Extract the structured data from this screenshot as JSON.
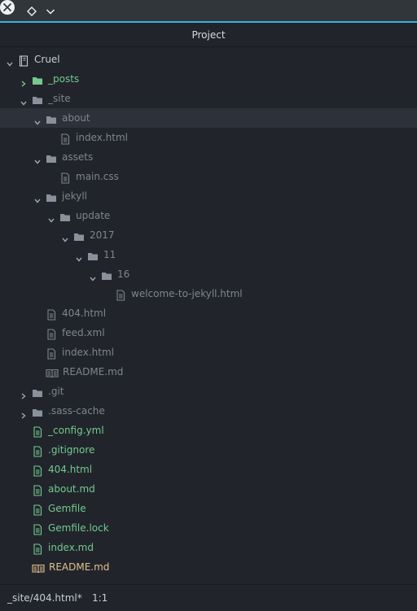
{
  "window": {
    "close_icon": "close-icon",
    "keep_above_icon": "diamond-icon",
    "menu_icon": "chevron-down-icon"
  },
  "panel": {
    "title": "Project"
  },
  "tree": [
    {
      "label": "Cruel",
      "type": "repo",
      "depth": 0,
      "expanded": true,
      "color": "root"
    },
    {
      "label": "_posts",
      "type": "folder",
      "depth": 1,
      "expanded": false,
      "color": "green"
    },
    {
      "label": "_site",
      "type": "folder",
      "depth": 1,
      "expanded": true,
      "color": "dim"
    },
    {
      "label": "about",
      "type": "folder",
      "depth": 2,
      "expanded": true,
      "color": "dim",
      "selected": true
    },
    {
      "label": "index.html",
      "type": "file",
      "depth": 3,
      "color": "dim"
    },
    {
      "label": "assets",
      "type": "folder",
      "depth": 2,
      "expanded": true,
      "color": "dim"
    },
    {
      "label": "main.css",
      "type": "file",
      "depth": 3,
      "color": "dim"
    },
    {
      "label": "jekyll",
      "type": "folder",
      "depth": 2,
      "expanded": true,
      "color": "dim"
    },
    {
      "label": "update",
      "type": "folder",
      "depth": 3,
      "expanded": true,
      "color": "dim"
    },
    {
      "label": "2017",
      "type": "folder",
      "depth": 4,
      "expanded": true,
      "color": "dim"
    },
    {
      "label": "11",
      "type": "folder",
      "depth": 5,
      "expanded": true,
      "color": "dim"
    },
    {
      "label": "16",
      "type": "folder",
      "depth": 6,
      "expanded": true,
      "color": "dim"
    },
    {
      "label": "welcome-to-jekyll.html",
      "type": "file",
      "depth": 7,
      "color": "dim"
    },
    {
      "label": "404.html",
      "type": "file",
      "depth": 2,
      "color": "dim"
    },
    {
      "label": "feed.xml",
      "type": "file",
      "depth": 2,
      "color": "dim"
    },
    {
      "label": "index.html",
      "type": "file",
      "depth": 2,
      "color": "dim"
    },
    {
      "label": "README.md",
      "type": "book",
      "depth": 2,
      "color": "dim"
    },
    {
      "label": ".git",
      "type": "folder",
      "depth": 1,
      "expanded": false,
      "color": "dim"
    },
    {
      "label": ".sass-cache",
      "type": "folder",
      "depth": 1,
      "expanded": false,
      "color": "dim"
    },
    {
      "label": "_config.yml",
      "type": "file",
      "depth": 1,
      "color": "green"
    },
    {
      "label": ".gitignore",
      "type": "file",
      "depth": 1,
      "color": "green"
    },
    {
      "label": "404.html",
      "type": "file",
      "depth": 1,
      "color": "green"
    },
    {
      "label": "about.md",
      "type": "file",
      "depth": 1,
      "color": "green"
    },
    {
      "label": "Gemfile",
      "type": "file",
      "depth": 1,
      "color": "green"
    },
    {
      "label": "Gemfile.lock",
      "type": "file",
      "depth": 1,
      "color": "green"
    },
    {
      "label": "index.md",
      "type": "file",
      "depth": 1,
      "color": "green"
    },
    {
      "label": "README.md",
      "type": "book",
      "depth": 1,
      "color": "yellow"
    }
  ],
  "colors": {
    "root": "#c8ccd4",
    "dim": "#7f848e",
    "green": "#73c990",
    "yellow": "#e2c08d",
    "accent": "#3daee9"
  },
  "status": {
    "path": "_site/404.html*",
    "position": "1:1"
  }
}
